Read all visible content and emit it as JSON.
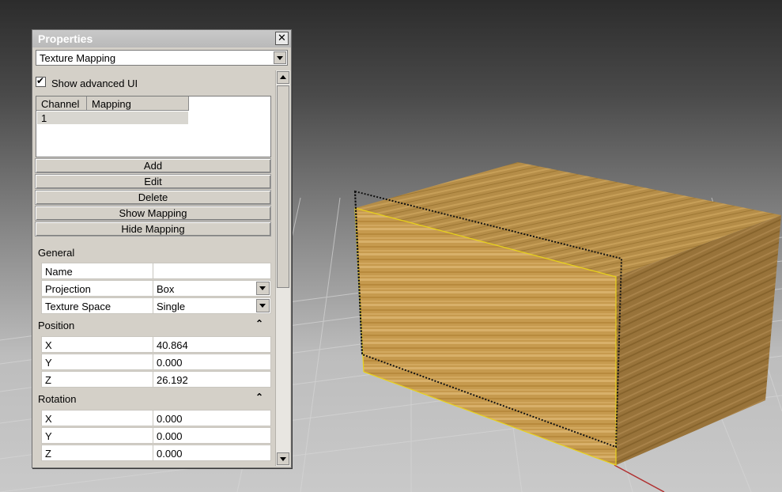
{
  "panel": {
    "title": "Properties",
    "close_glyph": "✕",
    "dropdown_value": "Texture Mapping",
    "show_advanced_label": "Show advanced UI",
    "show_advanced_checked": true
  },
  "channels": {
    "headers": [
      "Channel",
      "Mapping"
    ],
    "rows": [
      [
        "1",
        ""
      ]
    ]
  },
  "buttons": {
    "add": "Add",
    "edit": "Edit",
    "delete": "Delete",
    "show_mapping": "Show Mapping",
    "hide_mapping": "Hide Mapping"
  },
  "general": {
    "label": "General",
    "name_key": "Name",
    "name_value": "",
    "projection_key": "Projection",
    "projection_value": "Box",
    "texture_space_key": "Texture Space",
    "texture_space_value": "Single"
  },
  "position": {
    "label": "Position",
    "collapse_glyph": "⌃",
    "x_key": "X",
    "x": "40.864",
    "y_key": "Y",
    "y": "0.000",
    "z_key": "Z",
    "z": "26.192"
  },
  "rotation": {
    "label": "Rotation",
    "collapse_glyph": "⌃",
    "x_key": "X",
    "x": "0.000",
    "y_key": "Y",
    "y": "0.000",
    "z_key": "Z",
    "z": "0.000"
  },
  "colors": {
    "viewport_top": "#2c2c2c",
    "panel_bg": "#d4d0c8",
    "wood_light": "#c9a25a",
    "wood_dark": "#8f6b2c",
    "selection_edge": "#e8d21a",
    "axis_red": "#b03030"
  },
  "icons": [
    "close-icon",
    "dropdown-arrow-icon",
    "checkbox-check-icon",
    "collapse-chevron-icon",
    "scroll-up-icon",
    "scroll-down-icon"
  ]
}
